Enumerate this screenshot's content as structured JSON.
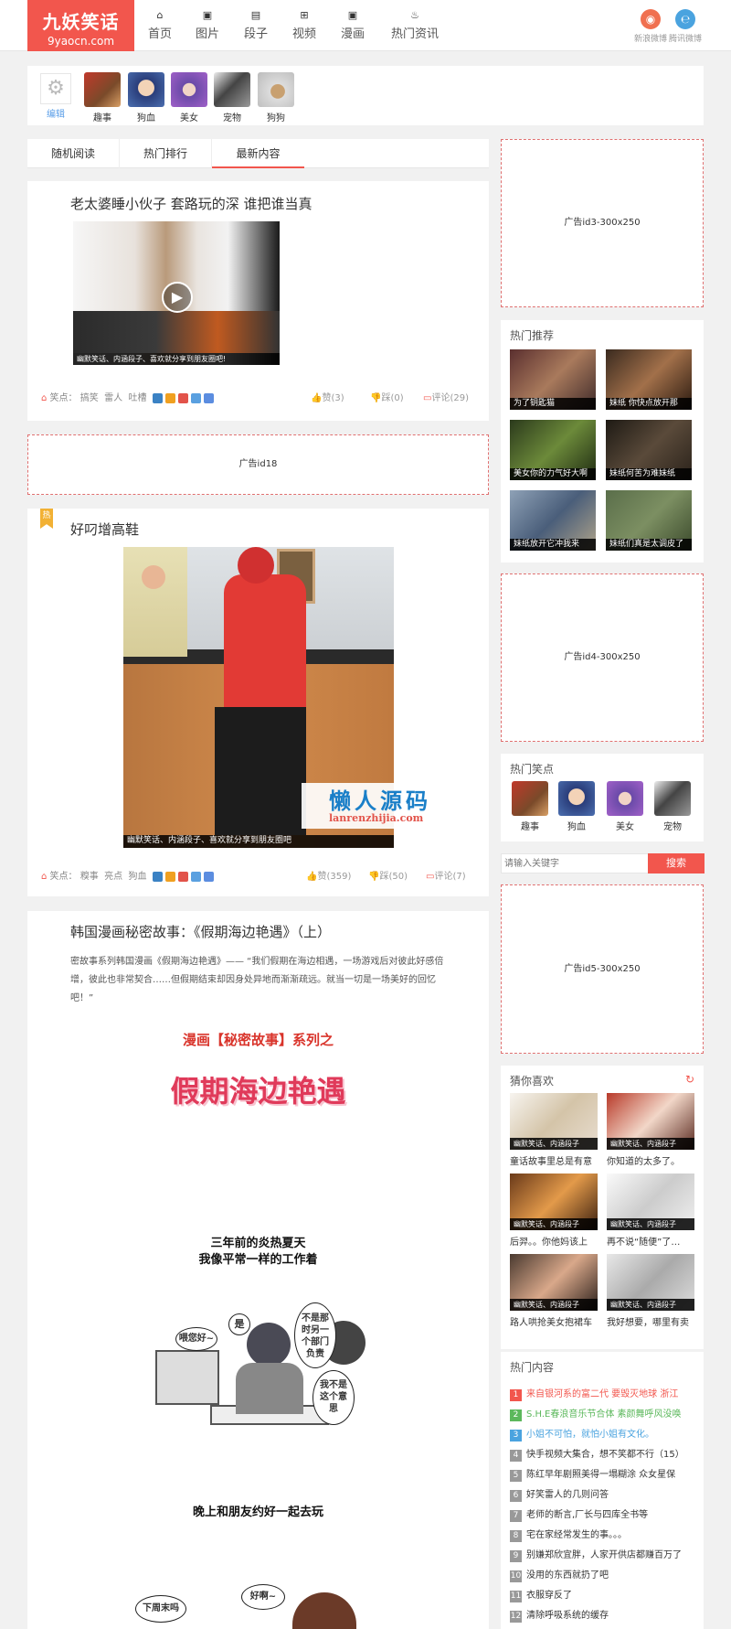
{
  "header": {
    "logo_title": "九妖笑话",
    "logo_url": "9yaocn.com",
    "nav": [
      {
        "label": "首页",
        "icon": "home-icon"
      },
      {
        "label": "图片",
        "icon": "image-icon"
      },
      {
        "label": "段子",
        "icon": "text-icon"
      },
      {
        "label": "视频",
        "icon": "video-icon"
      },
      {
        "label": "漫画",
        "icon": "comic-icon"
      },
      {
        "label": "热门资讯",
        "icon": "fire-icon"
      }
    ],
    "social": [
      {
        "label": "新浪微博",
        "color": "#f2564d"
      },
      {
        "label": "腾讯微博",
        "color": "#4aa3df"
      }
    ]
  },
  "category_bar": {
    "edit_label": "编辑",
    "items": [
      "趣事",
      "狗血",
      "美女",
      "宠物",
      "狗狗"
    ]
  },
  "tabs": [
    "随机阅读",
    "热门排行",
    "最新内容"
  ],
  "posts": [
    {
      "title": "老太婆睡小伙子 套路玩的深 谁把谁当真",
      "caption": "幽默笑话、内涵段子、喜欢就分享到朋友圈吧!",
      "tags_label": "笑点：",
      "tags": [
        "搞笑",
        "雷人",
        "吐槽"
      ],
      "likes": "赞(3)",
      "dislikes": "踩(0)",
      "comments": "评论(29)"
    },
    {
      "badge": "热",
      "title": "好叼增高鞋",
      "caption": "幽默笑话、内涵段子、喜欢就分享到朋友圈吧",
      "tags_label": "笑点：",
      "tags": [
        "糗事",
        "亮点",
        "狗血"
      ],
      "likes": "赞(359)",
      "dislikes": "踩(50)",
      "comments": "评论(7)",
      "watermark_cn": "懒人源码",
      "watermark_url": "lanrenzhijia.com"
    },
    {
      "title": "韩国漫画秘密故事：《假期海边艳遇》（上）",
      "excerpt": "密故事系列韩国漫画《假期海边艳遇》—— “我们假期在海边相遇，一场游戏后对彼此好感倍增，彼此也非常契合……但假期结束却因身处异地而渐渐疏远。就当一切是一场美好的回忆吧！”",
      "comic_series": "漫画【秘密故事】系列之",
      "comic_title": "假期海边艳遇",
      "comic_line1": "三年前的炎热夏天",
      "comic_line2": "我像平常一样的工作着",
      "bubble_hi": "喂您好~",
      "bubble_yes": "是",
      "bubble_q": "不是那时另一个部门负责",
      "bubble_no": "我不是这个意思",
      "comic_line3": "晚上和朋友约好一起去玩",
      "bubble_off": "下周末吗",
      "bubble_ok": "好啊~"
    }
  ],
  "ads": {
    "main": "广告id18",
    "side1": "广告id3-300x250",
    "side2": "广告id4-300x250",
    "side3": "广告id5-300x250"
  },
  "sidebar": {
    "hot_recommend_title": "热门推荐",
    "hot_recommend": [
      "为了钥匙猫",
      "妹纸 你快点放开那",
      "美女你的力气好大啊",
      "妹纸何苦为难妹纸",
      "妹纸放开它冲我来",
      "妹纸们真是太调皮了"
    ],
    "hot_points_title": "热门笑点",
    "hot_points": [
      "趣事",
      "狗血",
      "美女",
      "宠物"
    ],
    "search_placeholder": "请输入关键字",
    "search_button": "搜索",
    "guess_title": "猜你喜欢",
    "guess": [
      {
        "title": "童话故事里总是有意",
        "cap": "幽默笑话、内涵段子"
      },
      {
        "title": "你知道的太多了。",
        "cap": "幽默笑话、内涵段子"
      },
      {
        "title": "后羿。。你他妈该上",
        "cap": "幽默笑话、内涵段子"
      },
      {
        "title": "再不说“随便”了…",
        "cap": "幽默笑话、内涵段子"
      },
      {
        "title": "路人哄抢美女抱裙车",
        "cap": "幽默笑话、内涵段子"
      },
      {
        "title": "我好想要，哪里有卖",
        "cap": "幽默笑话、内涵段子"
      }
    ],
    "hot_content_title": "热门内容",
    "hot_content": [
      {
        "n": "1",
        "text": "来自银河系的富二代 要毁灭地球 浙江",
        "color": "#f2564d"
      },
      {
        "n": "2",
        "text": "S.H.E春浪音乐节合体 素颜舞呼风没唤",
        "color": "#5cb85c"
      },
      {
        "n": "3",
        "text": "小姐不可怕，就怕小姐有文化。",
        "color": "#4aa3df"
      },
      {
        "n": "4",
        "text": "快手视频大集合，想不笑都不行（15）",
        "color": "#999999"
      },
      {
        "n": "5",
        "text": "陈红早年剧照美得一塌糊涂 众女星保",
        "color": "#999999"
      },
      {
        "n": "6",
        "text": "好笑雷人的几则问答",
        "color": "#999999"
      },
      {
        "n": "7",
        "text": "老师的断言,厂长与四库全书等",
        "color": "#999999"
      },
      {
        "n": "8",
        "text": "宅在家经常发生的事。。。",
        "color": "#999999"
      },
      {
        "n": "9",
        "text": "别嫌郑欣宜胖，人家开供店都赚百万了",
        "color": "#999999"
      },
      {
        "n": "10",
        "text": "没用的东西就扔了吧",
        "color": "#999999"
      },
      {
        "n": "11",
        "text": "衣服穿反了",
        "color": "#999999"
      },
      {
        "n": "12",
        "text": "清除呼吸系统的缓存",
        "color": "#999999"
      }
    ]
  }
}
